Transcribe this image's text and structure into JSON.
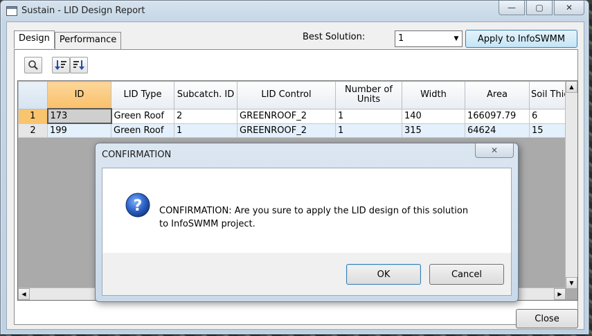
{
  "window": {
    "title": "Sustain - LID Design Report",
    "controls": {
      "minimize": "—",
      "maximize": "▢",
      "close": "✕"
    }
  },
  "tabs": [
    {
      "label": "Design",
      "active": true
    },
    {
      "label": "Performance",
      "active": false
    }
  ],
  "best_solution": {
    "label": "Best Solution:",
    "value": "1",
    "apply_label": "Apply to InfoSWMM"
  },
  "toolbar": {
    "icons": [
      "search-icon",
      "sort-ascending-icon",
      "sort-descending-icon"
    ]
  },
  "grid": {
    "columns": [
      "ID",
      "LID Type",
      "Subcatch. ID",
      "LID Control",
      "Number of Units",
      "Width",
      "Area",
      "Soil Thick"
    ],
    "rows": [
      {
        "row_num": "1",
        "cells": [
          "173",
          "Green Roof",
          "2",
          "GREENROOF_2",
          "1",
          "140",
          "166097.79",
          "6"
        ]
      },
      {
        "row_num": "2",
        "cells": [
          "199",
          "Green Roof",
          "1",
          "GREENROOF_2",
          "1",
          "315",
          "64624",
          "15"
        ]
      }
    ]
  },
  "close_label": "Close",
  "dialog": {
    "title": "CONFIRMATION",
    "close_glyph": "✕",
    "icon": "question-icon",
    "message_line1": "CONFIRMATION: Are you sure to apply the LID design of this solution",
    "message_line2": "to InfoSWMM project.",
    "ok_label": "OK",
    "cancel_label": "Cancel"
  },
  "colors": {
    "selected_header": "#f9c06a",
    "alt_row": "#e4f0fb",
    "accent_button": "#c4e5f6"
  }
}
